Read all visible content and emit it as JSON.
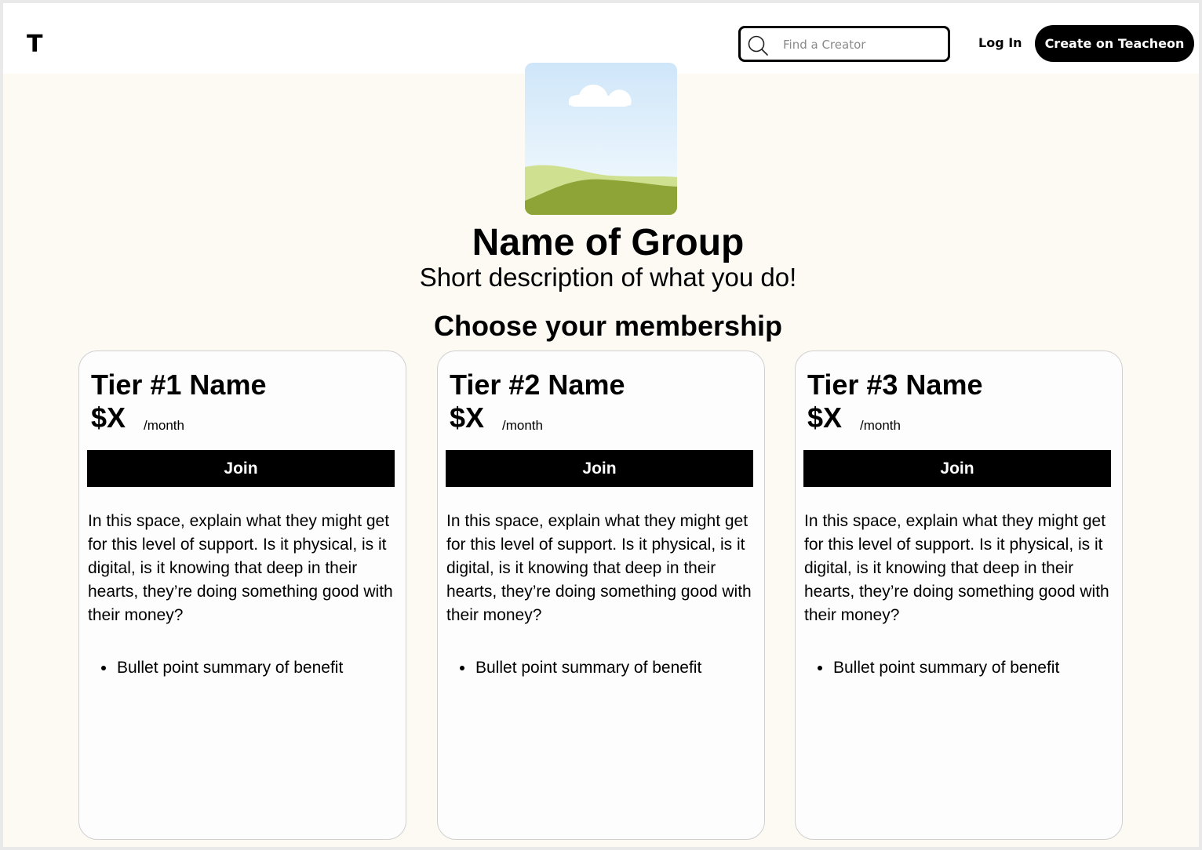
{
  "header": {
    "logo": "T",
    "search_placeholder": "Find a Creator",
    "login_label": "Log In",
    "create_label": "Create on Teacheon"
  },
  "group": {
    "image_icon": "landscape-placeholder-icon",
    "name": "Name of Group",
    "description": "Short description of what you do!"
  },
  "membership": {
    "title": "Choose your membership",
    "tiers": [
      {
        "name": "Tier #1 Name",
        "price": "$X",
        "period": "/month",
        "join_label": "Join",
        "description": "In this space, explain what they might get for this level of support. Is it physical, is it digital, is it knowing that deep in their hearts, they’re doing something good with their money?",
        "benefits": [
          "Bullet point summary of benefit"
        ]
      },
      {
        "name": "Tier #2 Name",
        "price": "$X",
        "period": "/month",
        "join_label": "Join",
        "description": "In this space, explain what they might get for this level of support. Is it physical, is it digital, is it knowing that deep in their hearts, they’re doing something good with their money?",
        "benefits": [
          "Bullet point summary of benefit"
        ]
      },
      {
        "name": "Tier #3 Name",
        "price": "$X",
        "period": "/month",
        "join_label": "Join",
        "description": "In this space, explain what they might get for this level of support. Is it physical, is it digital, is it knowing that deep in their hearts, they’re doing something good with their money?",
        "benefits": [
          "Bullet point summary of benefit"
        ]
      }
    ]
  },
  "colors": {
    "page_background": "#fdfaf4",
    "header_background": "#ffffff",
    "primary_button": "#000000",
    "card_border": "#d0d0d0"
  }
}
